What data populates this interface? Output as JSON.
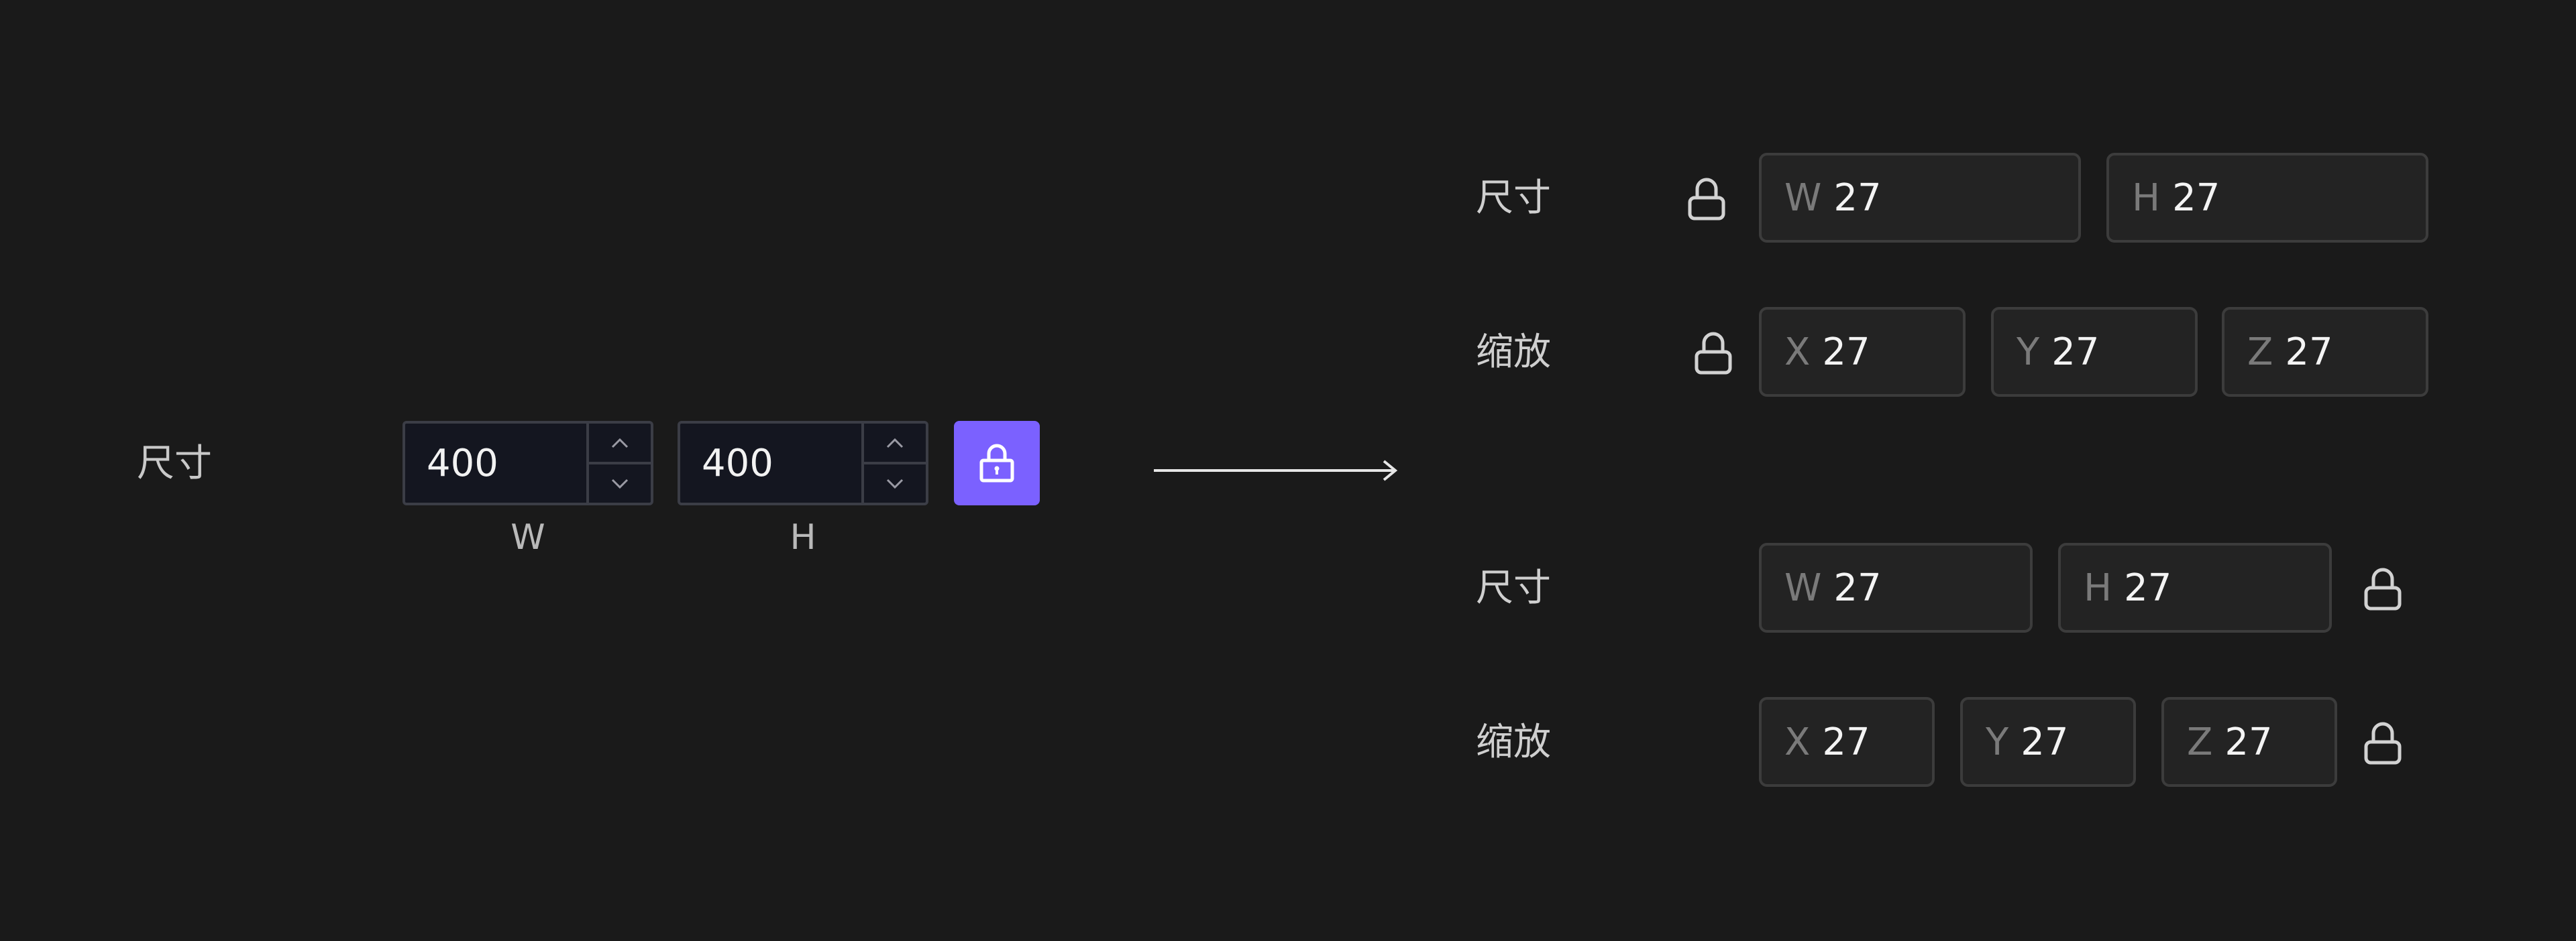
{
  "left": {
    "label": "尺寸",
    "width_value": "400",
    "height_value": "400",
    "width_caption": "W",
    "height_caption": "H",
    "accent_color": "#7b61ff"
  },
  "variant_a": {
    "size_label": "尺寸",
    "scale_label": "缩放",
    "size_fields": [
      {
        "axis": "W",
        "value": "27"
      },
      {
        "axis": "H",
        "value": "27"
      }
    ],
    "scale_fields": [
      {
        "axis": "X",
        "value": "27"
      },
      {
        "axis": "Y",
        "value": "27"
      },
      {
        "axis": "Z",
        "value": "27"
      }
    ]
  },
  "variant_b": {
    "size_label": "尺寸",
    "scale_label": "缩放",
    "size_fields": [
      {
        "axis": "W",
        "value": "27"
      },
      {
        "axis": "H",
        "value": "27"
      }
    ],
    "scale_fields": [
      {
        "axis": "X",
        "value": "27"
      },
      {
        "axis": "Y",
        "value": "27"
      },
      {
        "axis": "Z",
        "value": "27"
      }
    ]
  },
  "icons": [
    "chevron-up-icon",
    "chevron-down-icon",
    "lock-icon",
    "arrow-right-icon"
  ]
}
